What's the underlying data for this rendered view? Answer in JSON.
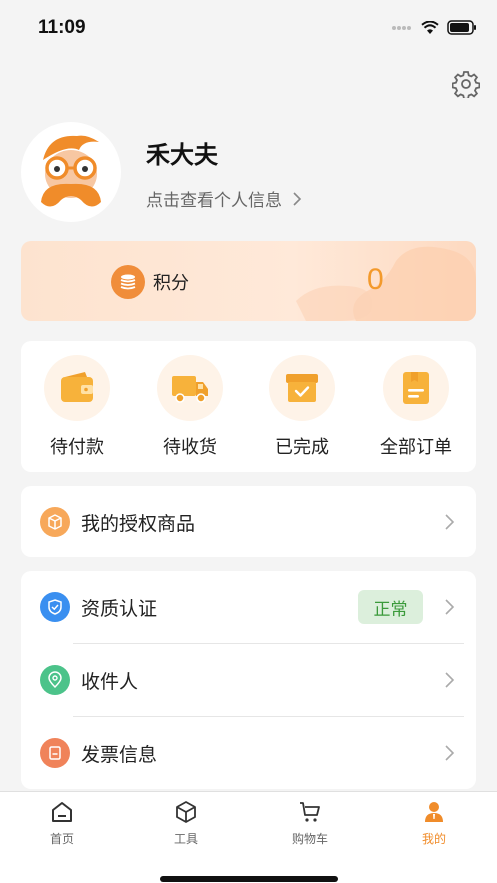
{
  "status_bar": {
    "time": "11:09"
  },
  "profile": {
    "name": "禾大夫",
    "view_info_label": "点击查看个人信息"
  },
  "points": {
    "label": "积分",
    "value": "0"
  },
  "orders": {
    "items": [
      {
        "label": "待付款",
        "icon": "wallet-icon"
      },
      {
        "label": "待收货",
        "icon": "truck-icon"
      },
      {
        "label": "已完成",
        "icon": "box-check-icon"
      },
      {
        "label": "全部订单",
        "icon": "order-list-icon"
      }
    ]
  },
  "menu": {
    "authorized_goods": "我的授权商品",
    "qualification": "资质认证",
    "qualification_status": "正常",
    "recipient": "收件人",
    "invoice": "发票信息"
  },
  "tabs": [
    {
      "label": "首页",
      "icon": "home-icon"
    },
    {
      "label": "工具",
      "icon": "cube-icon"
    },
    {
      "label": "购物车",
      "icon": "cart-icon"
    },
    {
      "label": "我的",
      "icon": "user-icon",
      "active": true
    }
  ],
  "colors": {
    "accent": "#f08c2a",
    "status_ok_bg": "#dcefdc",
    "status_ok_text": "#3a9a3a"
  }
}
